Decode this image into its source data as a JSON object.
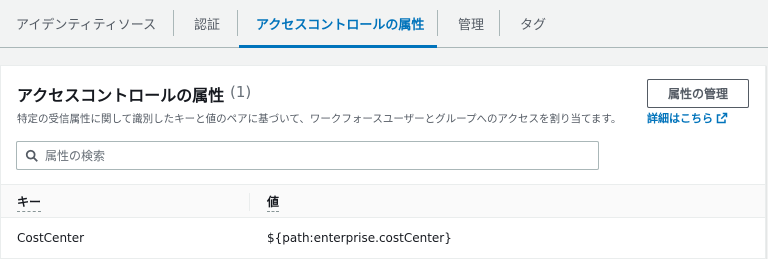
{
  "tabs": [
    {
      "label": "アイデンティティソース",
      "active": false
    },
    {
      "label": "認証",
      "active": false
    },
    {
      "label": "アクセスコントロールの属性",
      "active": true
    },
    {
      "label": "管理",
      "active": false
    },
    {
      "label": "タグ",
      "active": false
    }
  ],
  "panel": {
    "title": "アクセスコントロールの属性",
    "count": "(1)",
    "manage_button": "属性の管理",
    "description": "特定の受信属性に関して識別したキーと値のペアに基づいて、ワークフォースユーザーとグループへのアクセスを割り当てます。",
    "learn_more": "詳細はこちら",
    "learn_more_icon": "external-link-icon",
    "search_placeholder": "属性の検索",
    "search_value": "",
    "search_icon": "search-icon"
  },
  "table": {
    "columns": [
      "キー",
      "値"
    ],
    "rows": [
      {
        "key": "CostCenter",
        "value": "${path:enterprise.costCenter}"
      }
    ]
  },
  "colors": {
    "accent": "#0073bb",
    "text": "#16191f",
    "muted": "#545b64",
    "background": "#f2f3f3"
  }
}
